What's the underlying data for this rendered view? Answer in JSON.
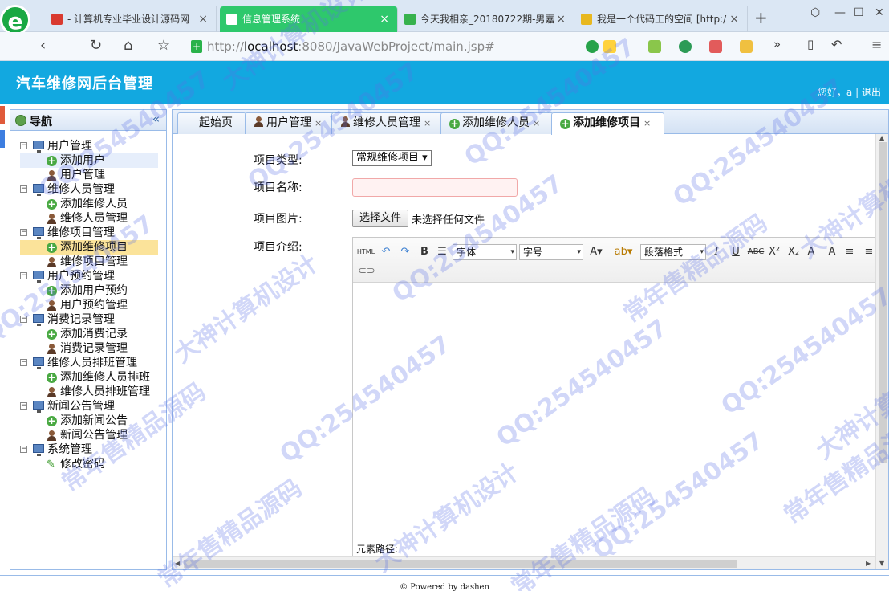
{
  "browser": {
    "tabs": [
      {
        "label": "- 计算机专业毕业设计源码网",
        "color": "#d93a2f"
      },
      {
        "label": "信息管理系统",
        "color": "#ffffff"
      },
      {
        "label": "今天我相亲_20180722期-男嘉",
        "color": "#37b24d"
      },
      {
        "label": "我是一个代码工的空间 [http:/",
        "color": "#e8b81f"
      }
    ],
    "url_prefix": "http://",
    "url_host": "localhost",
    "url_rest": ":8080/JavaWebProject/main.jsp#",
    "new_tab": "+"
  },
  "app": {
    "title": "汽车维修网后台管理",
    "greeting": "您好，a",
    "separator": "|",
    "logout": "退出",
    "header_color": "#12a8e0"
  },
  "sidebar": {
    "title": "导航",
    "collapse": "«",
    "tree": [
      {
        "label": "用户管理",
        "children": [
          {
            "label": "添加用户",
            "icon": "add-icon"
          },
          {
            "label": "用户管理",
            "icon": "user-icon"
          }
        ]
      },
      {
        "label": "维修人员管理",
        "children": [
          {
            "label": "添加维修人员",
            "icon": "add-icon"
          },
          {
            "label": "维修人员管理",
            "icon": "user-icon"
          }
        ]
      },
      {
        "label": "维修项目管理",
        "children": [
          {
            "label": "添加维修项目",
            "icon": "add-icon"
          },
          {
            "label": "维修项目管理",
            "icon": "user-icon"
          }
        ]
      },
      {
        "label": "用户预约管理",
        "children": [
          {
            "label": "添加用户预约",
            "icon": "add-icon"
          },
          {
            "label": "用户预约管理",
            "icon": "user-icon"
          }
        ]
      },
      {
        "label": "消费记录管理",
        "children": [
          {
            "label": "添加消费记录",
            "icon": "add-icon"
          },
          {
            "label": "消费记录管理",
            "icon": "user-icon"
          }
        ]
      },
      {
        "label": "维修人员排班管理",
        "children": [
          {
            "label": "添加维修人员排班",
            "icon": "add-icon"
          },
          {
            "label": "维修人员排班管理",
            "icon": "user-icon"
          }
        ]
      },
      {
        "label": "新闻公告管理",
        "children": [
          {
            "label": "添加新闻公告",
            "icon": "add-icon"
          },
          {
            "label": "新闻公告管理",
            "icon": "user-icon"
          }
        ]
      },
      {
        "label": "系统管理",
        "children": [
          {
            "label": "修改密码",
            "icon": "pen-icon"
          }
        ]
      }
    ],
    "selected": "添加维修项目",
    "hovered": "添加用户"
  },
  "panel_tabs": [
    {
      "label": "起始页",
      "icon": "",
      "closable": false
    },
    {
      "label": "用户管理",
      "icon": "user-icon",
      "closable": true
    },
    {
      "label": "维修人员管理",
      "icon": "user-icon",
      "closable": true
    },
    {
      "label": "添加维修人员",
      "icon": "add-icon",
      "closable": true
    },
    {
      "label": "添加维修项目",
      "icon": "add-icon",
      "closable": true,
      "active": true
    }
  ],
  "form": {
    "type_label": "项目类型:",
    "type_value": "常规维修项目",
    "name_label": "项目名称:",
    "name_value": "",
    "image_label": "项目图片:",
    "file_button": "选择文件",
    "file_status": "未选择任何文件",
    "intro_label": "项目介绍:"
  },
  "editor": {
    "html_btn": "HTML",
    "font_combo": "字体",
    "size_combo": "字号",
    "format_combo": "段落格式",
    "status": "元素路径:"
  },
  "footer": "© Powered by dashen",
  "watermarks": [
    "QQ:254540457",
    "大神计算机设计",
    "常年售精品源码"
  ]
}
